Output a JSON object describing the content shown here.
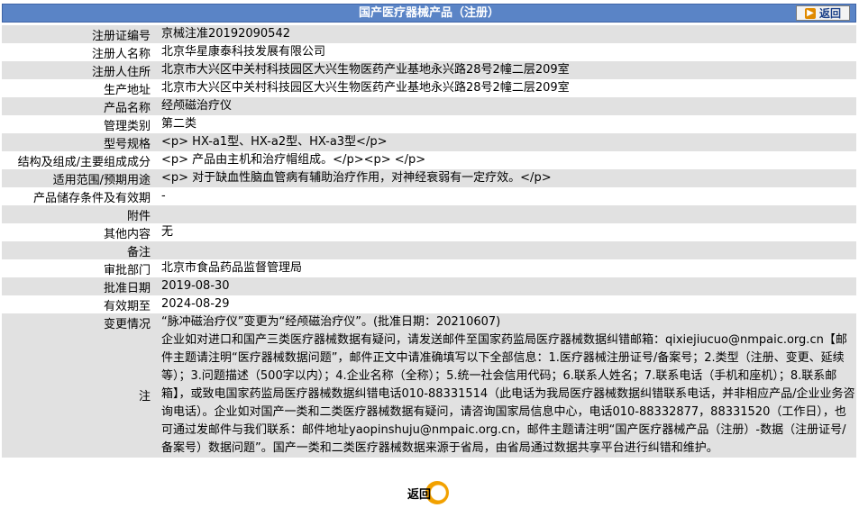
{
  "header": {
    "title": "国产医疗器械产品（注册）",
    "back_label": "返回"
  },
  "rows": [
    {
      "label": "注册证编号",
      "value": "京械注准20192090542"
    },
    {
      "label": "注册人名称",
      "value": "北京华星康泰科技发展有限公司"
    },
    {
      "label": "注册人住所",
      "value": "北京市大兴区中关村科技园区大兴生物医药产业基地永兴路28号2幢二层209室"
    },
    {
      "label": "生产地址",
      "value": "北京市大兴区中关村科技园区大兴生物医药产业基地永兴路28号2幢二层209室"
    },
    {
      "label": "产品名称",
      "value": "经颅磁治疗仪"
    },
    {
      "label": "管理类别",
      "value": "第二类"
    },
    {
      "label": "型号规格",
      "value": "<p> HX-a1型、HX-a2型、HX-a3型</p>"
    },
    {
      "label": "结构及组成/主要组成成分",
      "value": "<p> 产品由主机和治疗帽组成。</p><p> </p>"
    },
    {
      "label": "适用范围/预期用途",
      "value": "<p> 对于缺血性脑血管病有辅助治疗作用，对神经衰弱有一定疗效。</p>"
    },
    {
      "label": "产品储存条件及有效期",
      "value": "-"
    },
    {
      "label": "附件",
      "value": ""
    },
    {
      "label": "其他内容",
      "value": "无"
    },
    {
      "label": "备注",
      "value": ""
    },
    {
      "label": "审批部门",
      "value": "北京市食品药品监督管理局"
    },
    {
      "label": "批准日期",
      "value": "2019-08-30"
    },
    {
      "label": "有效期至",
      "value": "2024-08-29"
    },
    {
      "label": "变更情况",
      "value": "“脉冲磁治疗仪”变更为“经颅磁治疗仪”。(批准日期：20210607)"
    }
  ],
  "note": {
    "label": "注",
    "text": "企业如对进口和国产三类医疗器械数据有疑问，请发送邮件至国家药监局医疗器械数据纠错邮箱：qixiejiucuo@nmpaic.org.cn【邮件主题请注明“医疗器械数据问题”，邮件正文中请准确填写以下全部信息：1.医疗器械注册证号/备案号；2.类型（注册、变更、延续等）；3.问题描述（500字以内）；4.企业名称（全称）；5.统一社会信用代码；6.联系人姓名；7.联系电话（手机和座机）；8.联系邮箱】，或致电国家药监局医疗器械数据纠错电话010-88331514（此电话为我局医疗器械数据纠错联系电话，并非相应产品/企业业务咨询电话）。企业如对国产一类和二类医疗器械数据有疑问，请咨询国家局信息中心，电话010-88332877，88331520（工作日），也可通过发邮件与我们联系：邮件地址yaopinshuju@nmpaic.org.cn，邮件主题请注明“国产医疗器械产品（注册）-数据（注册证号/备案号）数据问题”。国产一类和二类医疗器械数据来源于省局，由省局通过数据共享平台进行纠错和维护。"
  },
  "footer": {
    "back_label": "返回"
  }
}
